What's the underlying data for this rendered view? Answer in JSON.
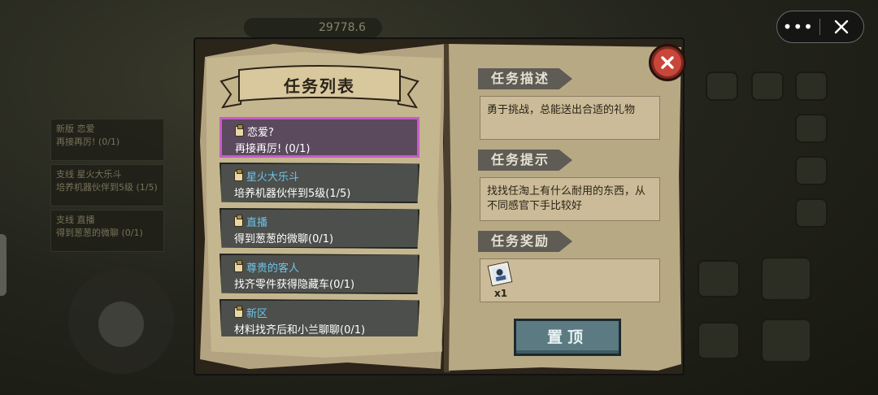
{
  "background": {
    "money": "29778.6",
    "left_quests": [
      {
        "title": "新版 恋爱",
        "detail": "再接再厉! (0/1)"
      },
      {
        "title": "支线 星火大乐斗",
        "detail": "培养机器伙伴到5级 (1/5)"
      },
      {
        "title": "支线 直播",
        "detail": "得到葱葱的微聊 (0/1)"
      }
    ]
  },
  "capsule": {
    "more_icon": "ellipsis-icon",
    "close_icon": "close-icon"
  },
  "panel": {
    "list_title": "任务列表",
    "quests": [
      {
        "title": "恋爱?",
        "detail": "再接再厉! (0/1)"
      },
      {
        "title": "星火大乐斗",
        "detail": "培养机器伙伴到5级(1/5)"
      },
      {
        "title": "直播",
        "detail": "得到葱葱的微聊(0/1)"
      },
      {
        "title": "尊贵的客人",
        "detail": "找齐零件获得隐藏车(0/1)"
      },
      {
        "title": "新区",
        "detail": "材料找齐后和小兰聊聊(0/1)"
      }
    ],
    "selected_index": 0,
    "description_label": "任务描述",
    "description_text": "勇于挑战，总能送出合适的礼物",
    "hint_label": "任务提示",
    "hint_text": "找找任淘上有什么耐用的东西，从不同感官下手比较好",
    "reward_label": "任务奖励",
    "reward_count": "x1",
    "pin_button": "置顶"
  }
}
